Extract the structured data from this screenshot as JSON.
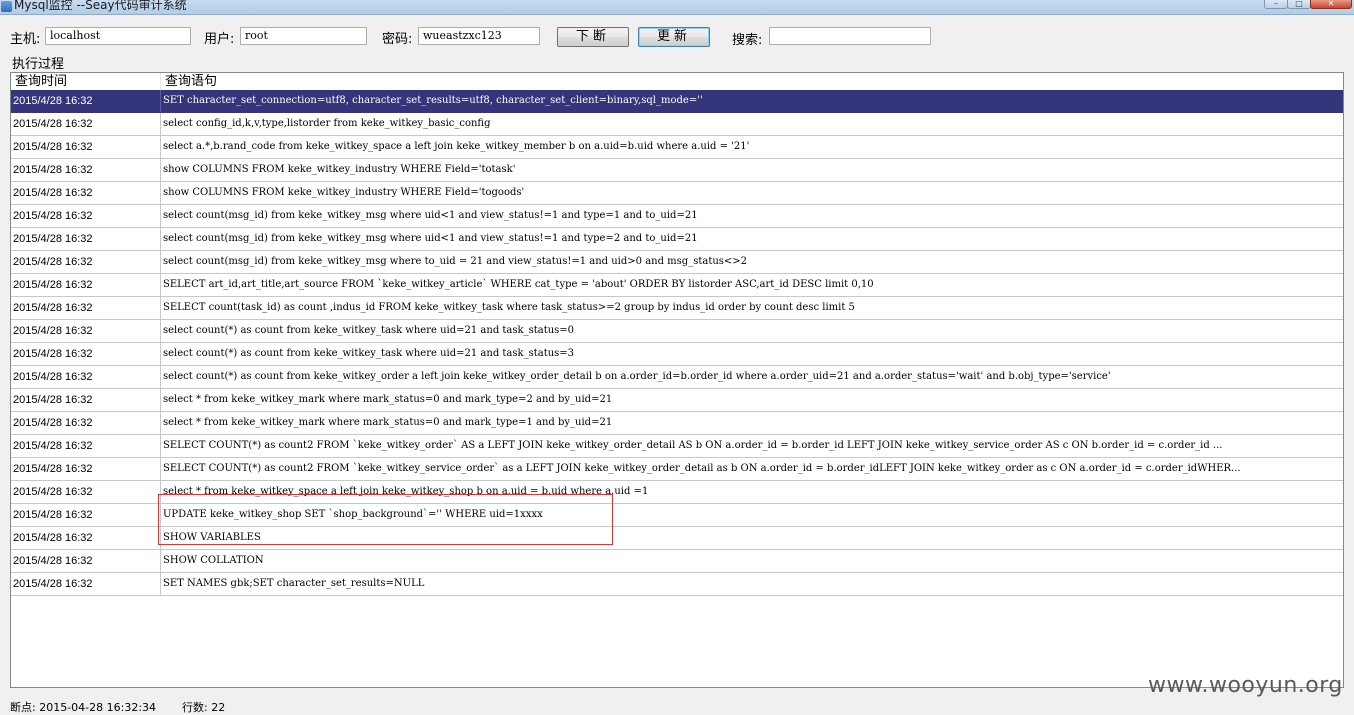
{
  "window": {
    "title": "Mysql监控 --Seay代码审计系统",
    "controls": [
      "minimize-icon",
      "maximize-icon",
      "close-icon"
    ]
  },
  "connection": {
    "host_label": "主机:",
    "host_value": "localhost",
    "user_label": "用户:",
    "user_value": "root",
    "password_label": "密码:",
    "password_value": "wueastzxc123",
    "breakpoint_button": "下断",
    "update_button": "更新",
    "search_label": "搜索:",
    "search_value": ""
  },
  "group_label": "执行过程",
  "table": {
    "columns": [
      "查询时间",
      "查询语句"
    ],
    "rows": [
      {
        "time": "2015/4/28 16:32",
        "sql": "SET character_set_connection=utf8, character_set_results=utf8, character_set_client=binary,sql_mode=''"
      },
      {
        "time": "2015/4/28 16:32",
        "sql": "select config_id,k,v,type,listorder from keke_witkey_basic_config"
      },
      {
        "time": "2015/4/28 16:32",
        "sql": "select a.*,b.rand_code from keke_witkey_space a left join keke_witkey_member b on a.uid=b.uid where  a.uid = '21'"
      },
      {
        "time": "2015/4/28 16:32",
        "sql": "show COLUMNS FROM keke_witkey_industry WHERE Field='totask'"
      },
      {
        "time": "2015/4/28 16:32",
        "sql": "show COLUMNS FROM keke_witkey_industry WHERE Field='togoods'"
      },
      {
        "time": "2015/4/28 16:32",
        "sql": "select count(msg_id) from keke_witkey_msg where uid<1 and view_status!=1 and type=1 and  to_uid=21"
      },
      {
        "time": "2015/4/28 16:32",
        "sql": "select count(msg_id) from keke_witkey_msg where uid<1 and view_status!=1 and type=2 and  to_uid=21"
      },
      {
        "time": "2015/4/28 16:32",
        "sql": "select count(msg_id) from keke_witkey_msg where to_uid = 21 and view_status!=1 and uid>0 and msg_status<>2"
      },
      {
        "time": "2015/4/28 16:32",
        "sql": "SELECT art_id,art_title,art_source FROM `keke_witkey_article` WHERE cat_type = 'about' ORDER BY listorder ASC,art_id DESC limit 0,10"
      },
      {
        "time": "2015/4/28 16:32",
        "sql": "SELECT count(task_id) as count ,indus_id FROM  keke_witkey_task where task_status>=2 group by indus_id order by count desc limit 5"
      },
      {
        "time": "2015/4/28 16:32",
        "sql": "select count(*) as count from keke_witkey_task where uid=21 and task_status=0"
      },
      {
        "time": "2015/4/28 16:32",
        "sql": "select count(*) as count from keke_witkey_task where uid=21 and task_status=3"
      },
      {
        "time": "2015/4/28 16:32",
        "sql": "select count(*) as count from keke_witkey_order a left join keke_witkey_order_detail b on a.order_id=b.order_id where a.order_uid=21 and a.order_status='wait' and b.obj_type='service'"
      },
      {
        "time": "2015/4/28 16:32",
        "sql": "select * from keke_witkey_mark where mark_status=0 and mark_type=2 and by_uid=21"
      },
      {
        "time": "2015/4/28 16:32",
        "sql": "select * from keke_witkey_mark where mark_status=0 and mark_type=1 and by_uid=21"
      },
      {
        "time": "2015/4/28 16:32",
        "sql": "SELECT COUNT(*) as count2 FROM `keke_witkey_order` AS a  LEFT JOIN keke_witkey_order_detail AS b ON a.order_id = b.order_id  LEFT JOIN keke_witkey_service_order AS c ON b.order_id = c.order_id ..."
      },
      {
        "time": "2015/4/28 16:32",
        "sql": "SELECT COUNT(*) as count2 FROM `keke_witkey_service_order` as a LEFT JOIN keke_witkey_order_detail as b ON a.order_id = b.order_idLEFT JOIN keke_witkey_order as c ON a.order_id = c.order_idWHER..."
      },
      {
        "time": "2015/4/28 16:32",
        "sql": "select * from keke_witkey_space a left join keke_witkey_shop b on a.uid = b.uid where a.uid =1"
      },
      {
        "time": "2015/4/28 16:32",
        "sql": "UPDATE keke_witkey_shop SET `shop_background`='' WHERE uid=1xxxx"
      },
      {
        "time": "2015/4/28 16:32",
        "sql": "SHOW VARIABLES"
      },
      {
        "time": "2015/4/28 16:32",
        "sql": "SHOW COLLATION"
      },
      {
        "time": "2015/4/28 16:32",
        "sql": "SET NAMES gbk;SET character_set_results=NULL"
      }
    ]
  },
  "status": {
    "breakpoint": "断点: 2015-04-28 16:32:34",
    "row_count": "行数: 22"
  },
  "watermark": "www.wooyun.org"
}
